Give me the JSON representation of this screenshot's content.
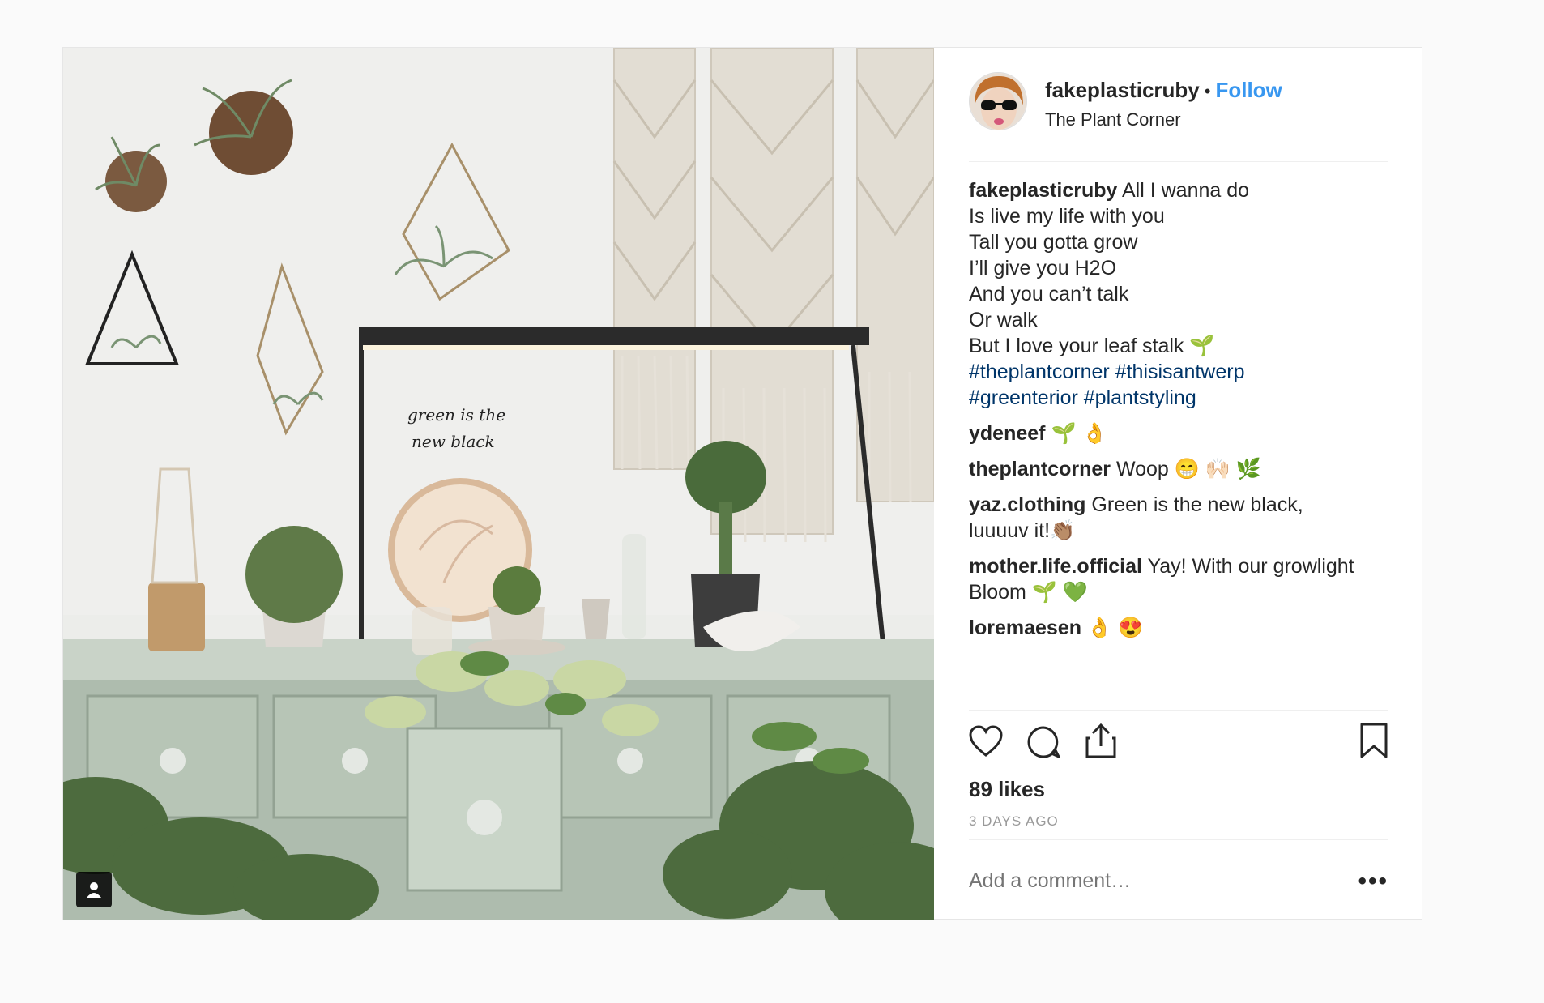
{
  "post": {
    "author": {
      "username": "fakeplasticruby",
      "follow_label": "Follow",
      "location": "The Plant Corner"
    },
    "caption": {
      "username": "fakeplasticruby",
      "lines": [
        "All I wanna do",
        "Is live my life with you",
        "Tall you gotta grow",
        "I’ll give you H2O",
        "And you can’t talk",
        "Or walk",
        "But I love your leaf stalk 🌱"
      ],
      "hashtags_line1": [
        "#theplantcorner",
        "#thisisantwerp"
      ],
      "hashtags_line2": [
        "#greenterior",
        "#plantstyling"
      ]
    },
    "comments": [
      {
        "username": "ydeneef",
        "text": "🌱 👌"
      },
      {
        "username": "theplantcorner",
        "text": "Woop 😁 🙌🏻 🌿"
      },
      {
        "username": "yaz.clothing",
        "text": "Green is the new black, luuuuv it!👏🏽"
      },
      {
        "username": "mother.life.official",
        "text": "Yay! With our growlight Bloom 🌱 💚"
      },
      {
        "username": "loremaesen",
        "text": "👌 😍"
      }
    ],
    "likes": "89 likes",
    "time_ago": "3 DAYS AGO",
    "add_comment_placeholder": "Add a comment…",
    "more_label": "•••",
    "photo_text": [
      "green is the",
      "new black"
    ],
    "icons": [
      "heart-icon",
      "comment-icon",
      "share-icon",
      "bookmark-icon",
      "user-tag-icon"
    ]
  }
}
